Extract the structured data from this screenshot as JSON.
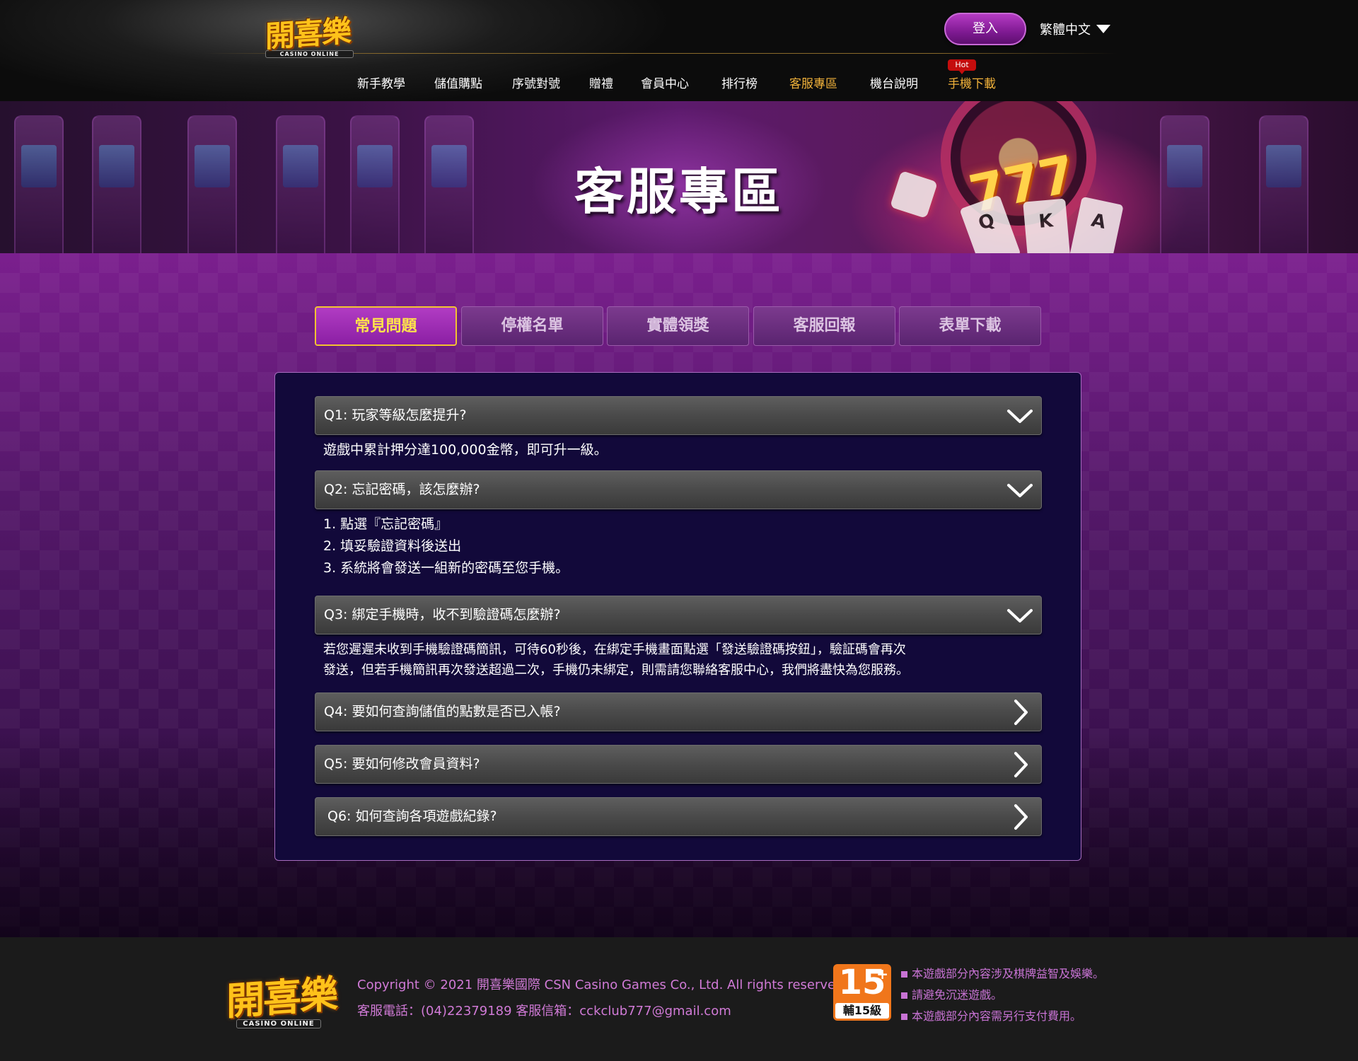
{
  "brand": {
    "logo_text": "開喜樂",
    "logo_subtext": "CASINO ONLINE"
  },
  "header": {
    "login_label": "登入",
    "language_label": "繁體中文"
  },
  "nav": {
    "items": [
      {
        "label": "新手教學"
      },
      {
        "label": "儲值購點"
      },
      {
        "label": "序號對號"
      },
      {
        "label": "贈禮"
      },
      {
        "label": "會員中心"
      },
      {
        "label": "排行榜"
      },
      {
        "label": "客服專區"
      },
      {
        "label": "機台說明"
      },
      {
        "label": "手機下載"
      }
    ],
    "hot_badge": "Hot",
    "active_index": 6
  },
  "banner": {
    "title": "客服專區",
    "cards": [
      "Q",
      "K",
      "A"
    ]
  },
  "tabs": [
    {
      "label": "常見問題",
      "active": true
    },
    {
      "label": "停權名單",
      "active": false
    },
    {
      "label": "實體領獎",
      "active": false
    },
    {
      "label": "客服回報",
      "active": false
    },
    {
      "label": "表單下載",
      "active": false
    }
  ],
  "faq": [
    {
      "question": "Q1: 玩家等級怎麼提升?",
      "expanded": true,
      "answer_lines": [
        "遊戲中累計押分達100,000金幣，即可升一級。"
      ]
    },
    {
      "question": "Q2: 忘記密碼，該怎麼辦?",
      "expanded": true,
      "answer_lines": [
        "1. 點選『忘記密碼』",
        "2. 填妥驗證資料後送出",
        "3. 系統將會發送一組新的密碼至您手機。"
      ]
    },
    {
      "question": "Q3: 綁定手機時，收不到驗證碼怎麼辦?",
      "expanded": true,
      "answer_lines": [
        "若您遲遲未收到手機驗證碼簡訊，可待60秒後，在綁定手機畫面點選「發送驗證碼按鈕」，驗証碼會再次",
        "發送，但若手機簡訊再次發送超過二次，手機仍未綁定，則需請您聯絡客服中心，我們將盡快為您服務。"
      ]
    },
    {
      "question": "Q4: 要如何查詢儲值的點數是否已入帳?",
      "expanded": false,
      "answer_lines": []
    },
    {
      "question": "Q5: 要如何修改會員資料?",
      "expanded": false,
      "answer_lines": []
    },
    {
      "question": "Q6: 如何查詢各項遊戲紀錄?",
      "expanded": false,
      "answer_lines": []
    }
  ],
  "footer": {
    "copyright": "Copyright © 2021   開喜樂國際 CSN Casino Games Co., Ltd. All rights reserved.",
    "contact": "客服電話：(04)22379189    客服信箱：cckclub777@gmail.com",
    "rating_number": "15",
    "rating_plus": "+",
    "rating_label": "輔15級",
    "notices": [
      "本遊戲部分內容涉及棋牌益智及娛樂。",
      "請避免沉迷遊戲。",
      "本遊戲部分內容需另行支付費用。"
    ]
  },
  "colors": {
    "accent_gold": "#f0b13a",
    "tab_active_text": "#ffe44a",
    "footer_text": "#d07ad6",
    "panel_bg": "#12093a"
  }
}
